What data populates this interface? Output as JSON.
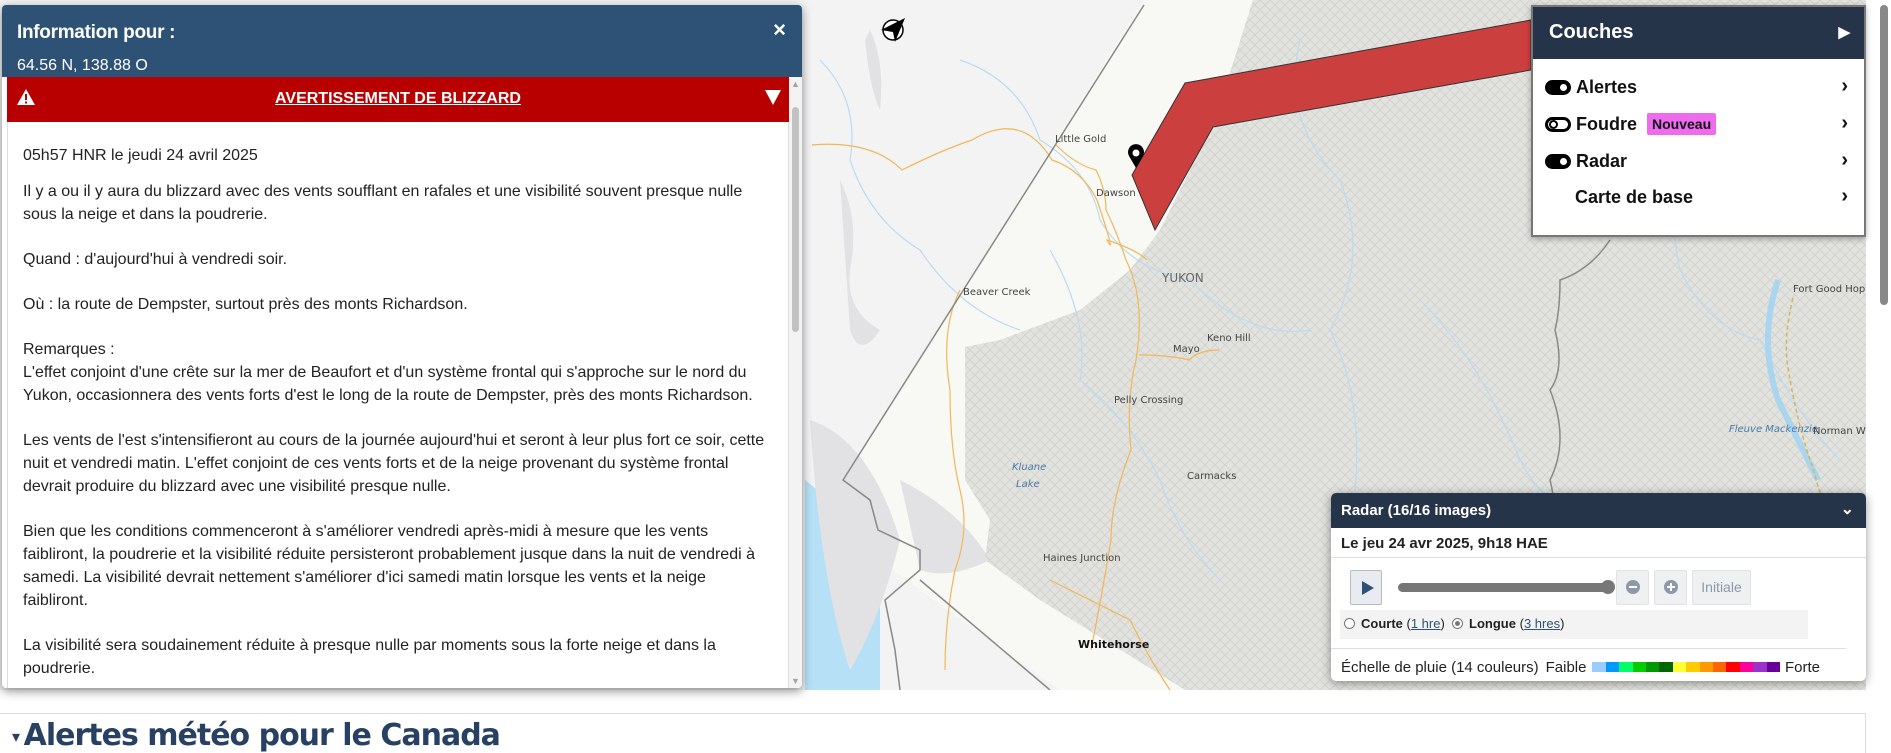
{
  "info_panel": {
    "title": "Information pour :",
    "coords": "64.56 N, 138.88 O",
    "close": "×",
    "warning_title": "AVERTISSEMENT DE BLIZZARD",
    "timestamp": "05h57 HNR le jeudi 24 avril 2025",
    "paragraphs": [
      "Il y a ou il y aura du blizzard avec des vents soufflant en rafales et une visibilité souvent presque nulle sous la neige et dans la poudrerie.",
      "Quand : d'aujourd'hui à vendredi soir.",
      "Où : la route de Dempster, surtout près des monts Richardson.",
      "Remarques :\nL'effet conjoint d'une crête sur la mer de Beaufort et d'un système frontal qui s'approche sur le nord du Yukon, occasionnera des vents forts d'est le long de la route de Dempster, près des monts Richardson.",
      "Les vents de l'est s'intensifieront au cours de la journée aujourd'hui et seront à leur plus fort ce soir, cette nuit et vendredi matin. L'effet conjoint de ces vents forts et de la neige provenant du système frontal devrait produire du blizzard avec une visibilité presque nulle.",
      "Bien que les conditions commenceront à s'améliorer vendredi après-midi à mesure que les vents faibliront, la poudrerie et la visibilité réduite persisteront probablement jusque dans la nuit de vendredi à samedi. La visibilité devrait nettement s'améliorer d'ici samedi matin lorsque les vents et la neige faibliront.",
      "La visibilité sera soudainement réduite à presque nulle par moments sous la forte neige et dans la poudrerie."
    ]
  },
  "layers": {
    "title": "Couches",
    "items": [
      {
        "label": "Alertes",
        "toggle": "on"
      },
      {
        "label": "Foudre",
        "toggle": "off",
        "badge": "Nouveau"
      },
      {
        "label": "Radar",
        "toggle": "on"
      },
      {
        "label": "Carte de base"
      }
    ]
  },
  "radar": {
    "title": "Radar (16/16 images)",
    "datetime": "Le jeu 24 avr 2025, 9h18 HAE",
    "progress": 1.0,
    "initial_label": "Initiale",
    "short_label": "Courte",
    "short_link": "1 hre",
    "long_label": "Longue",
    "long_link": "3 hres",
    "selected": "Longue",
    "scale_label": "Échelle de pluie (14 couleurs)",
    "weak": "Faible",
    "strong": "Forte",
    "scale_colors": [
      "#99ccff",
      "#0099ff",
      "#00ff66",
      "#00cc00",
      "#009900",
      "#006600",
      "#ffff33",
      "#ffcc00",
      "#ff9900",
      "#ff6600",
      "#ff0000",
      "#ff0099",
      "#9933cc",
      "#660099"
    ]
  },
  "map": {
    "labels": {
      "little_gold": "Little Gold",
      "dawson": "Dawson",
      "beaver_creek": "Beaver Creek",
      "yukon": "YUKON",
      "keno_hill": "Keno Hill",
      "mayo": "Mayo",
      "pelly": "Pelly Crossing",
      "carmacks": "Carmacks",
      "kluane1": "Kluane",
      "kluane2": "Lake",
      "haines": "Haines Junction",
      "whitehorse": "Whitehorse",
      "fort_good_hope": "Fort Good Hop",
      "mackenzie": "Fleuve Mackenzie",
      "norman": "Norman W"
    },
    "alert_color": "#cc3f3f"
  },
  "section_heading": "Alertes météo pour le Canada"
}
